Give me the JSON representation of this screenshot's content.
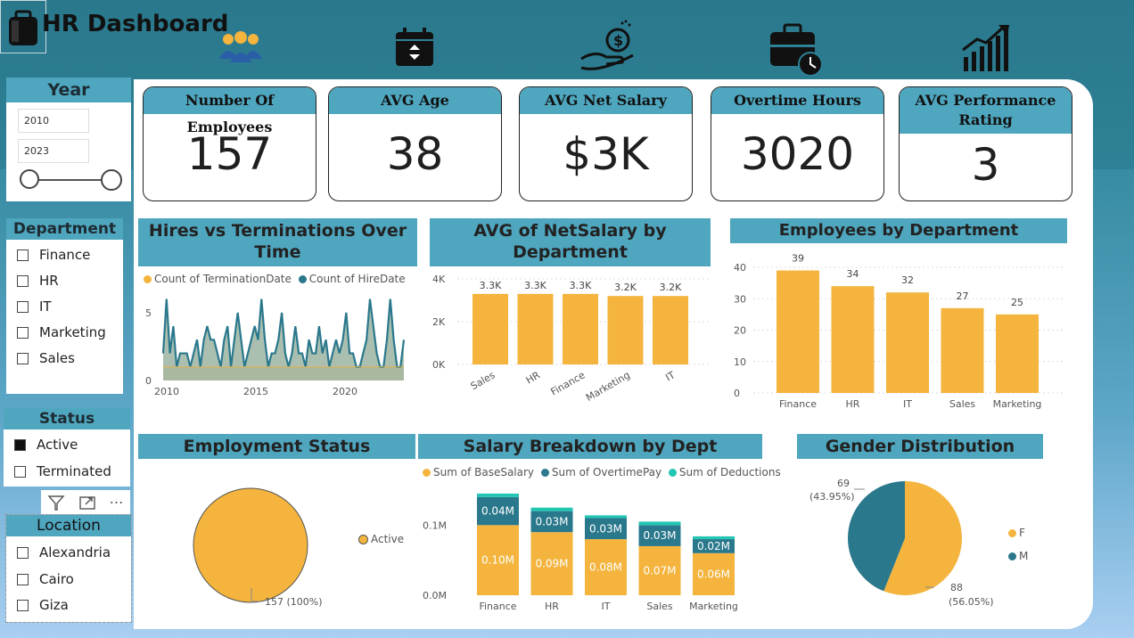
{
  "title": "HR Dashboard",
  "colors": {
    "accent": "#f4b43d",
    "teal": "#2a788c",
    "turq": "#23c6b3",
    "header": "#4fa6bf"
  },
  "top_icons": [
    "people-icon",
    "calendar-icon",
    "money-hand-icon",
    "briefcase-clock-icon",
    "growth-chart-icon"
  ],
  "year_slicer": {
    "title": "Year",
    "from": "2010",
    "to": "2023"
  },
  "department_slicer": {
    "title": "Department",
    "items": [
      {
        "label": "Finance",
        "checked": false
      },
      {
        "label": "HR",
        "checked": false
      },
      {
        "label": "IT",
        "checked": false
      },
      {
        "label": "Marketing",
        "checked": false
      },
      {
        "label": "Sales",
        "checked": false
      }
    ]
  },
  "status_slicer": {
    "title": "Status",
    "items": [
      {
        "label": "Active",
        "checked": true
      },
      {
        "label": "Terminated",
        "checked": false
      }
    ]
  },
  "location_slicer": {
    "title": "Location",
    "items": [
      {
        "label": "Alexandria",
        "checked": false
      },
      {
        "label": "Cairo",
        "checked": false
      },
      {
        "label": "Giza",
        "checked": false
      }
    ]
  },
  "toolbar": {
    "more": "⋯"
  },
  "kpis": [
    {
      "label": "Number Of Employees",
      "value": "157"
    },
    {
      "label": "AVG Age",
      "value": "38"
    },
    {
      "label": "AVG Net Salary",
      "value": "$3K"
    },
    {
      "label": "Overtime Hours",
      "value": "3020"
    },
    {
      "label": "AVG Performance Rating",
      "value": "3"
    }
  ],
  "chart_data": [
    {
      "type": "line",
      "title": "Hires vs Terminations Over Time",
      "series": [
        {
          "name": "Count of TerminationDate",
          "values": [
            1,
            1,
            1,
            1,
            1,
            1,
            1,
            1,
            1,
            1,
            1,
            1,
            1,
            1,
            1,
            1,
            1,
            1,
            1,
            1,
            1,
            1,
            1,
            1,
            1,
            1,
            1,
            1,
            1,
            1,
            1,
            1,
            1,
            1,
            1,
            1,
            1,
            1,
            1,
            1,
            1,
            1,
            1,
            1,
            1,
            1,
            1,
            1,
            1,
            1,
            1,
            1,
            1,
            1,
            1,
            1,
            1,
            1,
            1,
            1,
            1,
            1,
            1,
            1,
            1,
            1,
            1,
            1,
            1,
            1,
            1,
            1
          ]
        },
        {
          "name": "Count of HireDate",
          "values": [
            2,
            6,
            2,
            4,
            1,
            2,
            2,
            2,
            1,
            2,
            3,
            1,
            3,
            4,
            3,
            3,
            2,
            1,
            3,
            4,
            1,
            3,
            5,
            3,
            1,
            2,
            3,
            4,
            3,
            6,
            3,
            1,
            2,
            2,
            3,
            5,
            2,
            1,
            2,
            4,
            2,
            2,
            1,
            3,
            2,
            2,
            4,
            2,
            3,
            1,
            2,
            3,
            2,
            3,
            5,
            2,
            2,
            1,
            1,
            2,
            3,
            6,
            4,
            2,
            1,
            1,
            3,
            6,
            3,
            1,
            1,
            3
          ]
        }
      ],
      "x_ticks": [
        "2010",
        "2015",
        "2020"
      ],
      "y_ticks": [
        "0",
        "5"
      ],
      "ylim": [
        0,
        6.5
      ]
    },
    {
      "type": "bar",
      "title": "AVG of NetSalary by Department",
      "categories": [
        "Sales",
        "HR",
        "Finance",
        "Marketing",
        "IT"
      ],
      "values": [
        3300,
        3300,
        3300,
        3200,
        3200
      ],
      "labels": [
        "3.3K",
        "3.3K",
        "3.3K",
        "3.2K",
        "3.2K"
      ],
      "y_ticks": [
        "0K",
        "2K",
        "4K"
      ],
      "ylim": [
        0,
        4000
      ]
    },
    {
      "type": "bar",
      "title": "Employees by Department",
      "categories": [
        "Finance",
        "HR",
        "IT",
        "Sales",
        "Marketing"
      ],
      "values": [
        39,
        34,
        32,
        27,
        25
      ],
      "y_ticks": [
        "0",
        "10",
        "20",
        "30",
        "40"
      ],
      "ylim": [
        0,
        40
      ]
    },
    {
      "type": "pie",
      "title": "Employment Status",
      "slices": [
        {
          "name": "Active",
          "value": 157,
          "label": "157 (100%)"
        }
      ],
      "legend": [
        "Active"
      ]
    },
    {
      "type": "bar",
      "stacked": true,
      "title": "Salary Breakdown by Dept",
      "categories": [
        "Finance",
        "HR",
        "IT",
        "Sales",
        "Marketing"
      ],
      "series": [
        {
          "name": "Sum of BaseSalary",
          "values": [
            0.1,
            0.09,
            0.08,
            0.07,
            0.06
          ],
          "labels": [
            "0.10M",
            "0.09M",
            "0.08M",
            "0.07M",
            "0.06M"
          ]
        },
        {
          "name": "Sum of OvertimePay",
          "values": [
            0.04,
            0.03,
            0.03,
            0.03,
            0.02
          ],
          "labels": [
            "0.04M",
            "0.03M",
            "0.03M",
            "0.03M",
            "0.02M"
          ]
        },
        {
          "name": "Sum of Deductions",
          "values": [
            0.005,
            0.005,
            0.004,
            0.005,
            0.004
          ],
          "labels": [
            "",
            "",
            "",
            "",
            ""
          ]
        }
      ],
      "y_ticks": [
        "0.0M",
        "0.1M"
      ],
      "ylim": [
        0,
        0.15
      ]
    },
    {
      "type": "pie",
      "title": "Gender Distribution",
      "slices": [
        {
          "name": "F",
          "value": 88,
          "label": "88",
          "pct": "(56.05%)"
        },
        {
          "name": "M",
          "value": 69,
          "label": "69",
          "pct": "(43.95%)"
        }
      ]
    }
  ]
}
